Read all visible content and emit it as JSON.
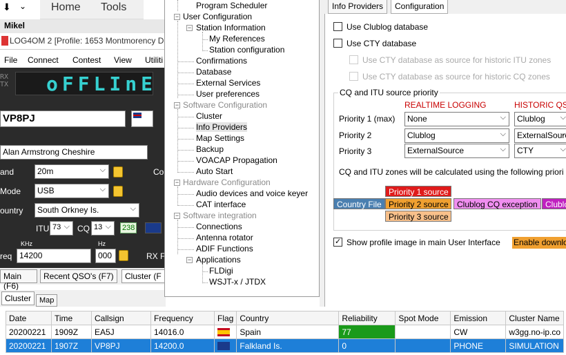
{
  "ribbon": {
    "home": "Home",
    "tools": "Tools",
    "user_short": "Mikel"
  },
  "main_window": {
    "title": "LOG4OM 2 [Profile: 1653 Montmorency D",
    "menu": [
      "File",
      "Connect",
      "Contest",
      "View",
      "Utiliti"
    ],
    "lcd": {
      "text": "oFFLInE",
      "rx": "RX",
      "tx": "TX"
    },
    "callsign": "VP8PJ",
    "name": "Alan Armstrong Cheshire",
    "band": {
      "label": "and",
      "value": "20m"
    },
    "mode": {
      "label": "Mode",
      "value": "USB"
    },
    "country": {
      "label": "ountry",
      "value": "South Orkney Is."
    },
    "itu": {
      "label": "ITU",
      "value": "73"
    },
    "cq": {
      "label": "CQ",
      "value": "13"
    },
    "dxcc": "238",
    "freq": {
      "label": "req",
      "khz_label": "KHz",
      "value": "14200",
      "hz_label": "Hz",
      "hz": "000"
    },
    "rx_label": "RX F",
    "co_label": "Co",
    "tabs": [
      "Main (F6)",
      "Recent QSO's (F7)",
      "Cluster (F"
    ],
    "subtabs": [
      "Cluster",
      "Map"
    ]
  },
  "cluster_grid": {
    "headers": [
      "Date",
      "Time",
      "Callsign",
      "Frequency",
      "Flag",
      "Country",
      "Reliability",
      "Spot Mode",
      "Emission",
      "Cluster Name"
    ],
    "rows": [
      {
        "date": "20200221",
        "time": "1909Z",
        "call": "EA5J",
        "freq": "14016.0",
        "country": "Spain",
        "rel": "77",
        "emission": "CW",
        "cluster": "w3gg.no-ip.co"
      },
      {
        "date": "20200221",
        "time": "1907Z",
        "call": "VP8PJ",
        "freq": "14200.0",
        "country": "Falkland Is.",
        "rel": "0",
        "emission": "PHONE",
        "cluster": "SIMULATION"
      }
    ]
  },
  "tree": {
    "items": [
      "Program Scheduler",
      "User Configuration",
      "Station Information",
      "My References",
      "Station configuration",
      "Confirmations",
      "Database",
      "External Services",
      "User preferences",
      "Software Configuration",
      "Cluster",
      "Info Providers",
      "Map Settings",
      "Backup",
      "VOACAP Propagation",
      "Auto Start",
      "Hardware Configuration",
      "Audio devices and voice keyer",
      "CAT interface",
      "Software integration",
      "Connections",
      "Antenna rotator",
      "ADIF Functions",
      "Applications",
      "FLDigi",
      "WSJT-x / JTDX"
    ]
  },
  "config_panel": {
    "tabs": [
      "Info Providers",
      "Configuration"
    ],
    "use_clublog": "Use Clublog database",
    "use_cty": "Use CTY database",
    "cty_itu": "Use CTY database as source for historic ITU zones",
    "cty_cq": "Use CTY database as source for historic CQ zones",
    "group_title": "CQ and ITU source priority",
    "col_realtime": "REALTIME LOGGING",
    "col_historic": "HISTORIC QSO",
    "priorities": [
      {
        "label": "Priority 1 (max)",
        "realtime": "None",
        "historic": "Clublog"
      },
      {
        "label": "Priority 2",
        "realtime": "Clublog",
        "historic": "ExternalSource"
      },
      {
        "label": "Priority 3",
        "realtime": "ExternalSource",
        "historic": "CTY"
      }
    ],
    "calc_text": "CQ and ITU zones will be calculated using the following priori",
    "legend": {
      "p1": "Priority 1 source",
      "country_file": "Country File",
      "p2": "Priority 2 source",
      "clublog_exc": "Clublog CQ exception",
      "clublog": "Clublo",
      "p3": "Priority 3 source"
    },
    "show_profile": "Show profile image in main User Interface",
    "enable_download": "Enable downlo"
  },
  "colors": {
    "accent": "#1e7fd8",
    "lcd": "#36d0d0",
    "p1": "#e01b1b",
    "p2": "#f0a030",
    "p3": "#f8c08a",
    "country_file": "#4a7fb0",
    "clublog_exc": "#f08ef0",
    "clublog": "#c020c0"
  }
}
